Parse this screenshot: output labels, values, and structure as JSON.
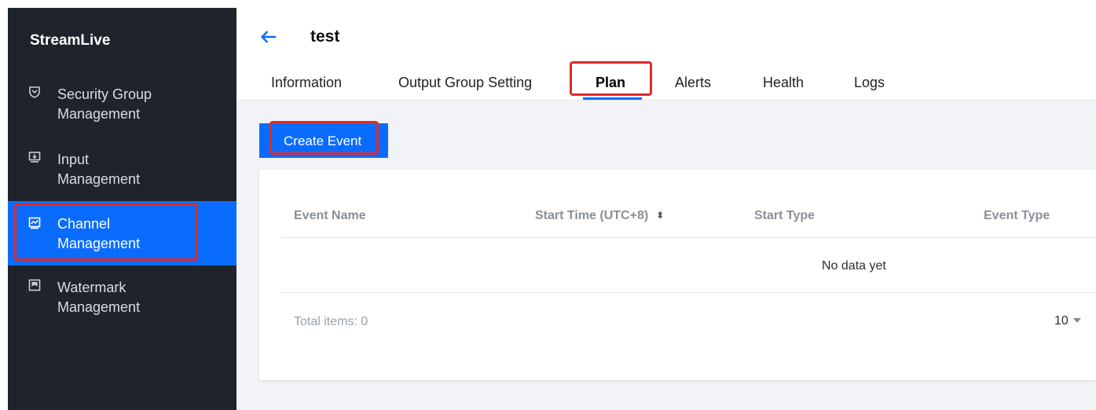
{
  "sidebar": {
    "brand": "StreamLive",
    "items": [
      {
        "label": "Security Group\nManagement",
        "icon": "shield-icon",
        "active": false
      },
      {
        "label": "Input\nManagement",
        "icon": "input-icon",
        "active": false
      },
      {
        "label": "Channel\nManagement",
        "icon": "channel-icon",
        "active": true
      },
      {
        "label": "Watermark\nManagement",
        "icon": "watermark-icon",
        "active": false
      }
    ]
  },
  "header": {
    "title": "test",
    "tabs": [
      {
        "label": "Information",
        "active": false
      },
      {
        "label": "Output Group Setting",
        "active": false
      },
      {
        "label": "Plan",
        "active": true
      },
      {
        "label": "Alerts",
        "active": false
      },
      {
        "label": "Health",
        "active": false
      },
      {
        "label": "Logs",
        "active": false
      }
    ]
  },
  "content": {
    "create_button": "Create Event",
    "table": {
      "columns": [
        "Event Name",
        "Start Time (UTC+8)",
        "Start Type",
        "Event Type"
      ],
      "empty_text": "No data yet",
      "total_label": "Total items: 0",
      "page_size": "10"
    }
  },
  "colors": {
    "accent": "#0a6cff",
    "sidebar_bg": "#1f232b",
    "highlight_outline": "#e12a2a"
  }
}
